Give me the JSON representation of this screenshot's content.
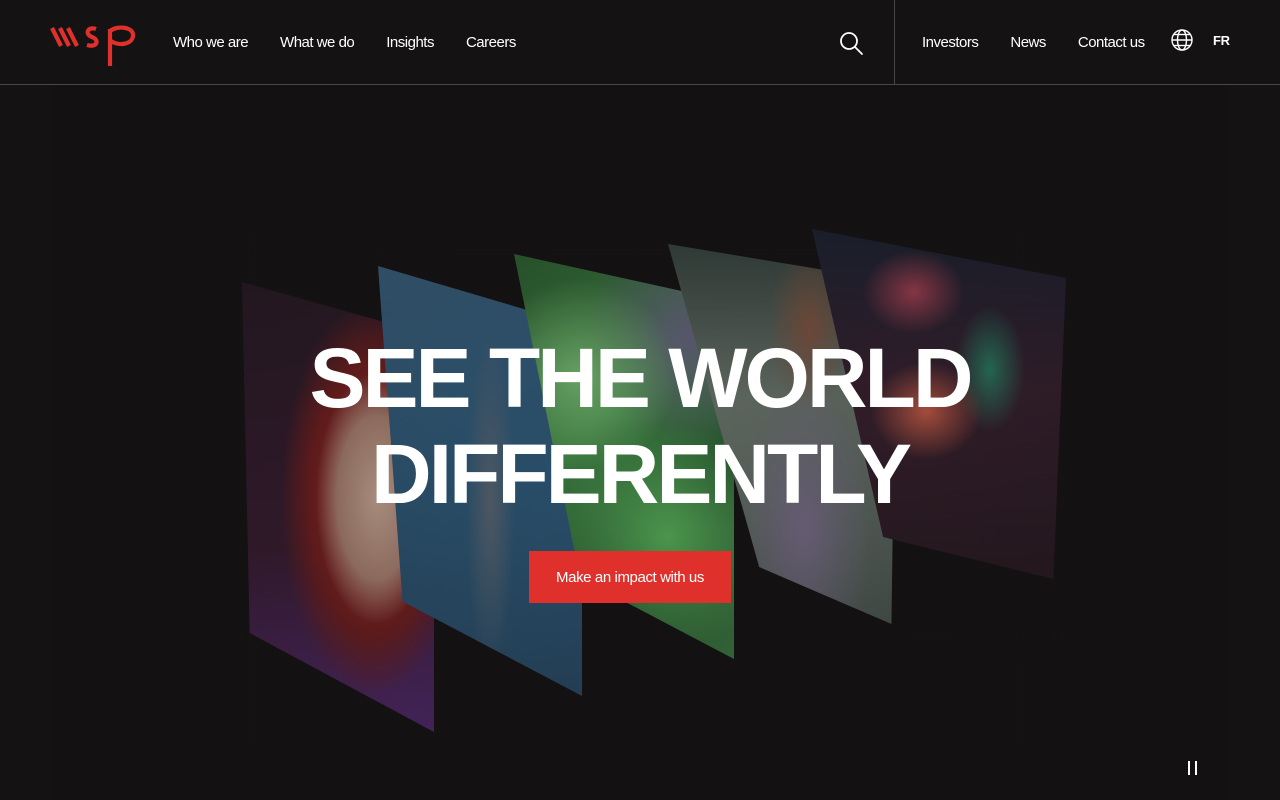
{
  "brand": {
    "logo_text": "wsp",
    "accent_color": "#e0302b",
    "background_color": "#141213"
  },
  "nav": {
    "primary": [
      {
        "label": "Who we are"
      },
      {
        "label": "What we do"
      },
      {
        "label": "Insights"
      },
      {
        "label": "Careers"
      }
    ],
    "search_icon": "search-icon",
    "secondary": [
      {
        "label": "Investors"
      },
      {
        "label": "News"
      },
      {
        "label": "Contact us"
      }
    ],
    "language_icon": "globe-icon",
    "language_label": "FR"
  },
  "hero": {
    "title_line_1": "SEE THE WORLD",
    "title_line_2": "DIFFERENTLY",
    "cta_label": "Make an impact with us",
    "media_control_icon": "pause-icon"
  }
}
